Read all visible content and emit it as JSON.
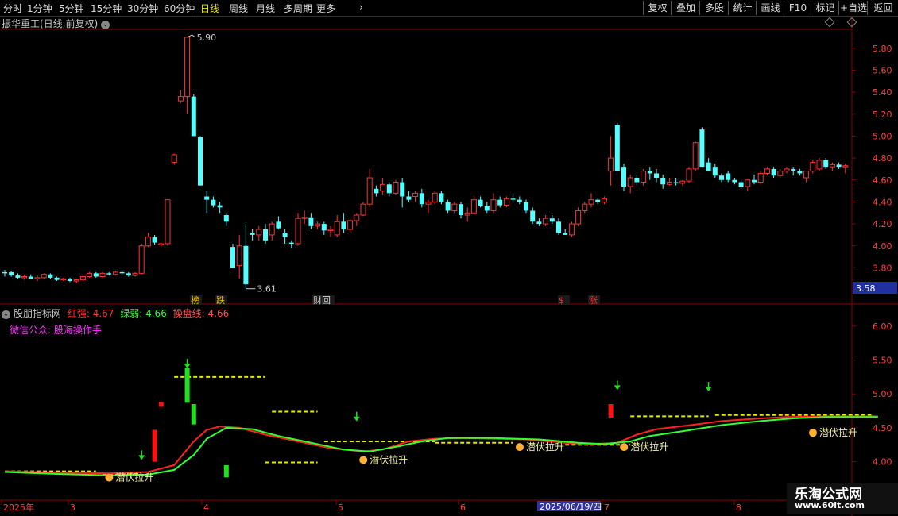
{
  "toolbar": {
    "periods": [
      "分时",
      "1分钟",
      "5分钟",
      "15分钟",
      "30分钟",
      "60分钟",
      "日线",
      "周线",
      "月线",
      "多周期",
      "更多"
    ],
    "active_period": "日线",
    "right_buttons": [
      "复权",
      "叠加",
      "多股",
      "统计",
      "画线",
      "F10",
      "标记",
      "+自选",
      "返回"
    ]
  },
  "title": "振华重工(日线,前复权)",
  "indicator": {
    "name": "股朋指标网",
    "red_label": "红强: 4.67",
    "green_label": "绿弱: 4.66",
    "line_label": "操盘线: 4.66",
    "wechat": "微信公众: 股海操作手",
    "signal_label": "潜伏拉升"
  },
  "price_axis": [
    "5.80",
    "5.60",
    "5.40",
    "5.20",
    "5.00",
    "4.80",
    "4.60",
    "4.40",
    "4.20",
    "4.00",
    "3.80"
  ],
  "ind_axis": [
    "6.00",
    "5.50",
    "5.00",
    "4.50",
    "4.00"
  ],
  "current_price": "3.58",
  "high_label": "5.90",
  "low_label": "3.61",
  "event_marks": [
    {
      "text": "榜",
      "color": "#e8c000"
    },
    {
      "text": "跌",
      "color": "#e8c000"
    },
    {
      "text": "财回",
      "color": "#ddd"
    },
    {
      "text": "$",
      "color": "#ff3030"
    },
    {
      "text": "涨",
      "color": "#ff3030"
    }
  ],
  "x_axis": [
    "2025年",
    "3",
    "4",
    "5",
    "6",
    "2025/06/19/四",
    "7",
    "8"
  ],
  "watermark": {
    "line1": "乐淘公式网",
    "line2": "www.60lt.com"
  },
  "colors": {
    "up": "#ff3232",
    "down": "#54ffff",
    "red_line": "#ff2020",
    "green_line": "#30ff30",
    "dashed": "#e8e800"
  },
  "chart_data": {
    "type": "candlestick",
    "ylim": [
      3.55,
      5.95
    ],
    "candles": [
      [
        3.76,
        3.78,
        3.72,
        3.75
      ],
      [
        3.76,
        3.77,
        3.72,
        3.73
      ],
      [
        3.73,
        3.75,
        3.7,
        3.71
      ],
      [
        3.71,
        3.74,
        3.69,
        3.72
      ],
      [
        3.72,
        3.74,
        3.7,
        3.7
      ],
      [
        3.7,
        3.73,
        3.68,
        3.71
      ],
      [
        3.71,
        3.75,
        3.7,
        3.74
      ],
      [
        3.74,
        3.75,
        3.7,
        3.71
      ],
      [
        3.71,
        3.72,
        3.68,
        3.69
      ],
      [
        3.69,
        3.71,
        3.68,
        3.7
      ],
      [
        3.7,
        3.71,
        3.67,
        3.68
      ],
      [
        3.68,
        3.7,
        3.66,
        3.69
      ],
      [
        3.69,
        3.73,
        3.68,
        3.72
      ],
      [
        3.72,
        3.76,
        3.71,
        3.75
      ],
      [
        3.75,
        3.76,
        3.71,
        3.72
      ],
      [
        3.72,
        3.76,
        3.71,
        3.75
      ],
      [
        3.75,
        3.76,
        3.73,
        3.74
      ],
      [
        3.74,
        3.77,
        3.73,
        3.76
      ],
      [
        3.76,
        3.78,
        3.74,
        3.75
      ],
      [
        3.75,
        3.76,
        3.72,
        3.73
      ],
      [
        3.73,
        3.76,
        3.72,
        3.75
      ],
      [
        3.75,
        4.02,
        3.74,
        4.0
      ],
      [
        4.0,
        4.12,
        3.99,
        4.08
      ],
      [
        4.08,
        4.1,
        4.01,
        4.03
      ],
      [
        4.01,
        4.03,
        4.0,
        4.02
      ],
      [
        4.02,
        4.42,
        4.0,
        4.42
      ],
      [
        4.76,
        4.84,
        4.74,
        4.83
      ],
      [
        5.32,
        5.42,
        5.3,
        5.36
      ],
      [
        5.36,
        5.9,
        5.2,
        5.9
      ],
      [
        5.36,
        5.38,
        5.0,
        5.0
      ],
      [
        4.99,
        5.0,
        4.55,
        4.55
      ],
      [
        4.45,
        4.5,
        4.3,
        4.42
      ],
      [
        4.42,
        4.45,
        4.35,
        4.37
      ],
      [
        4.37,
        4.4,
        4.3,
        4.35
      ],
      [
        4.28,
        4.3,
        4.18,
        4.22
      ],
      [
        3.99,
        4.02,
        3.8,
        3.8
      ],
      [
        3.82,
        4.1,
        3.7,
        4.0
      ],
      [
        4.0,
        4.2,
        3.61,
        3.65
      ],
      [
        4.12,
        4.15,
        4.05,
        4.1
      ],
      [
        4.1,
        4.18,
        4.05,
        4.15
      ],
      [
        4.15,
        4.2,
        4.02,
        4.05
      ],
      [
        4.1,
        4.22,
        4.05,
        4.2
      ],
      [
        4.22,
        4.27,
        4.15,
        4.16
      ],
      [
        4.12,
        4.15,
        4.02,
        4.08
      ],
      [
        4.03,
        4.05,
        3.98,
        4.02
      ],
      [
        4.02,
        4.3,
        4.0,
        4.25
      ],
      [
        4.25,
        4.32,
        4.2,
        4.26
      ],
      [
        4.26,
        4.3,
        4.15,
        4.18
      ],
      [
        4.18,
        4.22,
        4.15,
        4.2
      ],
      [
        4.2,
        4.22,
        4.1,
        4.14
      ],
      [
        4.14,
        4.18,
        4.08,
        4.15
      ],
      [
        4.1,
        4.28,
        4.08,
        4.22
      ],
      [
        4.22,
        4.3,
        4.12,
        4.15
      ],
      [
        4.15,
        4.25,
        4.12,
        4.23
      ],
      [
        4.23,
        4.3,
        4.18,
        4.28
      ],
      [
        4.28,
        4.4,
        4.27,
        4.38
      ],
      [
        4.38,
        4.7,
        4.35,
        4.62
      ],
      [
        4.52,
        4.55,
        4.45,
        4.48
      ],
      [
        4.5,
        4.62,
        4.46,
        4.56
      ],
      [
        4.56,
        4.58,
        4.45,
        4.48
      ],
      [
        4.48,
        4.6,
        4.46,
        4.58
      ],
      [
        4.58,
        4.62,
        4.35,
        4.45
      ],
      [
        4.45,
        4.5,
        4.4,
        4.42
      ],
      [
        4.45,
        4.5,
        4.4,
        4.48
      ],
      [
        4.48,
        4.52,
        4.35,
        4.38
      ],
      [
        4.38,
        4.42,
        4.3,
        4.4
      ],
      [
        4.4,
        4.5,
        4.38,
        4.48
      ],
      [
        4.48,
        4.5,
        4.38,
        4.4
      ],
      [
        4.4,
        4.42,
        4.3,
        4.32
      ],
      [
        4.32,
        4.4,
        4.3,
        4.38
      ],
      [
        4.38,
        4.4,
        4.25,
        4.28
      ],
      [
        4.28,
        4.35,
        4.22,
        4.3
      ],
      [
        4.3,
        4.45,
        4.28,
        4.42
      ],
      [
        4.42,
        4.45,
        4.35,
        4.36
      ],
      [
        4.36,
        4.4,
        4.3,
        4.32
      ],
      [
        4.32,
        4.48,
        4.3,
        4.42
      ],
      [
        4.42,
        4.45,
        4.35,
        4.37
      ],
      [
        4.37,
        4.45,
        4.35,
        4.43
      ],
      [
        4.43,
        4.48,
        4.4,
        4.42
      ],
      [
        4.42,
        4.45,
        4.38,
        4.4
      ],
      [
        4.4,
        4.42,
        4.3,
        4.32
      ],
      [
        4.32,
        4.35,
        4.2,
        4.22
      ],
      [
        4.22,
        4.25,
        4.18,
        4.2
      ],
      [
        4.2,
        4.28,
        4.18,
        4.25
      ],
      [
        4.25,
        4.28,
        4.2,
        4.22
      ],
      [
        4.22,
        4.25,
        4.1,
        4.12
      ],
      [
        4.12,
        4.15,
        4.1,
        4.1
      ],
      [
        4.1,
        4.22,
        4.08,
        4.2
      ],
      [
        4.2,
        4.35,
        4.18,
        4.32
      ],
      [
        4.32,
        4.4,
        4.3,
        4.38
      ],
      [
        4.38,
        4.48,
        4.35,
        4.42
      ],
      [
        4.42,
        4.43,
        4.38,
        4.4
      ],
      [
        4.4,
        4.45,
        4.38,
        4.43
      ],
      [
        4.68,
        5.0,
        4.55,
        4.8
      ],
      [
        5.1,
        5.12,
        4.68,
        4.68
      ],
      [
        4.72,
        4.75,
        4.5,
        4.54
      ],
      [
        4.54,
        4.65,
        4.48,
        4.62
      ],
      [
        4.62,
        4.65,
        4.55,
        4.58
      ],
      [
        4.58,
        4.7,
        4.55,
        4.68
      ],
      [
        4.68,
        4.72,
        4.6,
        4.66
      ],
      [
        4.66,
        4.7,
        4.58,
        4.62
      ],
      [
        4.62,
        4.65,
        4.52,
        4.56
      ],
      [
        4.56,
        4.62,
        4.55,
        4.58
      ],
      [
        4.58,
        4.62,
        4.55,
        4.57
      ],
      [
        4.57,
        4.6,
        4.55,
        4.59
      ],
      [
        4.59,
        4.72,
        4.57,
        4.7
      ],
      [
        4.7,
        4.95,
        4.68,
        4.94
      ],
      [
        5.06,
        5.08,
        4.72,
        4.72
      ],
      [
        4.76,
        4.8,
        4.7,
        4.68
      ],
      [
        4.72,
        4.75,
        4.62,
        4.64
      ],
      [
        4.64,
        4.66,
        4.58,
        4.6
      ],
      [
        4.66,
        4.68,
        4.58,
        4.6
      ],
      [
        4.6,
        4.62,
        4.56,
        4.58
      ],
      [
        4.58,
        4.6,
        4.52,
        4.54
      ],
      [
        4.54,
        4.6,
        4.5,
        4.6
      ],
      [
        4.6,
        4.65,
        4.56,
        4.58
      ],
      [
        4.58,
        4.68,
        4.56,
        4.66
      ],
      [
        4.66,
        4.72,
        4.64,
        4.7
      ],
      [
        4.7,
        4.72,
        4.62,
        4.64
      ],
      [
        4.64,
        4.7,
        4.62,
        4.68
      ],
      [
        4.68,
        4.72,
        4.66,
        4.7
      ],
      [
        4.7,
        4.72,
        4.64,
        4.68
      ],
      [
        4.68,
        4.7,
        4.64,
        4.66
      ],
      [
        4.62,
        4.68,
        4.58,
        4.68
      ],
      [
        4.68,
        4.78,
        4.66,
        4.76
      ],
      [
        4.7,
        4.8,
        4.68,
        4.78
      ],
      [
        4.78,
        4.8,
        4.7,
        4.72
      ],
      [
        4.72,
        4.76,
        4.68,
        4.74
      ],
      [
        4.74,
        4.76,
        4.7,
        4.72
      ],
      [
        4.72,
        4.75,
        4.66,
        4.73
      ]
    ],
    "indicator": {
      "ylim": [
        3.75,
        6.15
      ],
      "red_line": [
        [
          0,
          3.86
        ],
        [
          8,
          3.84
        ],
        [
          16,
          3.83
        ],
        [
          22,
          3.85
        ],
        [
          26,
          3.95
        ],
        [
          29,
          4.3
        ],
        [
          31,
          4.47
        ],
        [
          33,
          4.52
        ],
        [
          36,
          4.5
        ],
        [
          40,
          4.4
        ],
        [
          45,
          4.3
        ],
        [
          50,
          4.2
        ],
        [
          55,
          4.15
        ],
        [
          58,
          4.18
        ],
        [
          62,
          4.3
        ],
        [
          66,
          4.34
        ],
        [
          70,
          4.35
        ],
        [
          80,
          4.33
        ],
        [
          86,
          4.28
        ],
        [
          90,
          4.26
        ],
        [
          94,
          4.28
        ],
        [
          97,
          4.4
        ],
        [
          100,
          4.48
        ],
        [
          106,
          4.55
        ],
        [
          110,
          4.6
        ],
        [
          116,
          4.64
        ],
        [
          120,
          4.66
        ],
        [
          126,
          4.67
        ],
        [
          134,
          4.67
        ]
      ],
      "green_line": [
        [
          0,
          3.85
        ],
        [
          8,
          3.82
        ],
        [
          16,
          3.8
        ],
        [
          22,
          3.81
        ],
        [
          26,
          3.88
        ],
        [
          29,
          4.1
        ],
        [
          31,
          4.34
        ],
        [
          34,
          4.5
        ],
        [
          38,
          4.48
        ],
        [
          42,
          4.38
        ],
        [
          47,
          4.28
        ],
        [
          52,
          4.18
        ],
        [
          56,
          4.15
        ],
        [
          60,
          4.22
        ],
        [
          64,
          4.3
        ],
        [
          68,
          4.35
        ],
        [
          75,
          4.35
        ],
        [
          82,
          4.33
        ],
        [
          88,
          4.28
        ],
        [
          92,
          4.26
        ],
        [
          96,
          4.3
        ],
        [
          99,
          4.38
        ],
        [
          104,
          4.45
        ],
        [
          110,
          4.54
        ],
        [
          116,
          4.6
        ],
        [
          121,
          4.64
        ],
        [
          126,
          4.66
        ],
        [
          134,
          4.66
        ]
      ],
      "signals": [
        17,
        56,
        80,
        96,
        125
      ]
    }
  }
}
